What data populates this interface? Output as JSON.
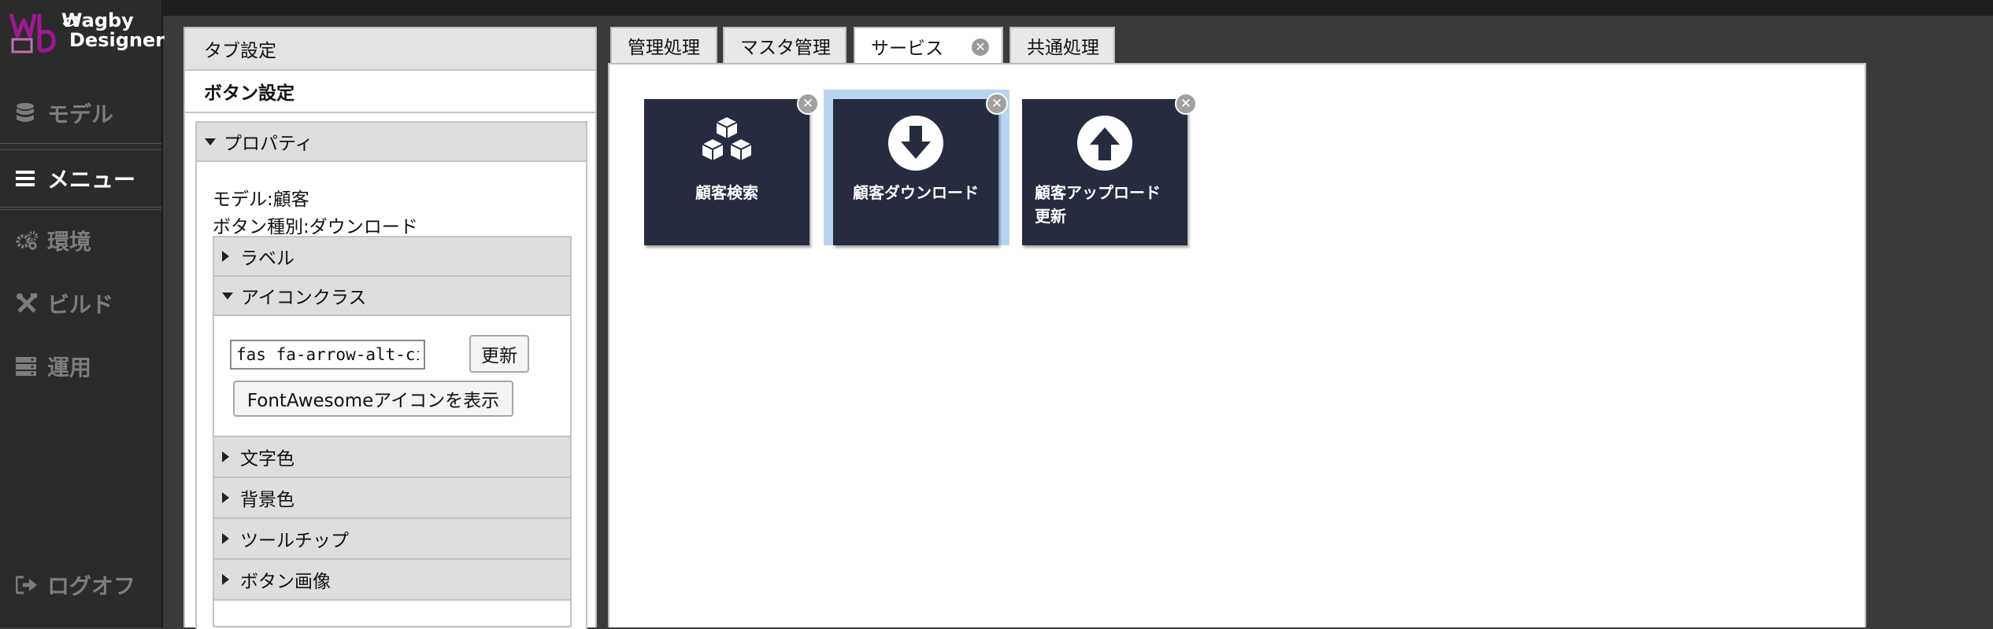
{
  "brand": {
    "line1": "Wagby",
    "line2": "Designer"
  },
  "nav": {
    "items": [
      {
        "label": "モデル",
        "icon": "database-icon"
      },
      {
        "label": "メニュー",
        "icon": "menu-bars-icon",
        "active": true
      },
      {
        "label": "環境",
        "icon": "cogs-icon"
      },
      {
        "label": "ビルド",
        "icon": "tools-icon"
      },
      {
        "label": "運用",
        "icon": "server-icon"
      }
    ],
    "logoff": "ログオフ"
  },
  "panel": {
    "tab_settings": "タブ設定",
    "button_settings": "ボタン設定",
    "properties": {
      "header": "プロパティ",
      "model_line": "モデル:顧客",
      "button_type_line": "ボタン種別:ダウンロード",
      "sections": {
        "label": "ラベル",
        "icon_class": "アイコンクラス",
        "text_color": "文字色",
        "bg_color": "背景色",
        "tooltip": "ツールチップ",
        "button_image": "ボタン画像"
      },
      "icon_class_value": "fas fa-arrow-alt-circle-down",
      "update_button": "更新",
      "fontawesome_button": "FontAwesomeアイコンを表示"
    }
  },
  "tabs": [
    {
      "label": "管理処理"
    },
    {
      "label": "マスタ管理"
    },
    {
      "label": "サービス",
      "active": true,
      "closable": true
    },
    {
      "label": "共通処理"
    }
  ],
  "tiles": [
    {
      "label": "顧客検索",
      "icon": "cubes-icon"
    },
    {
      "label": "顧客ダウンロード",
      "icon": "arrow-circle-down-icon",
      "selected": true
    },
    {
      "label_line1": "顧客アップロード",
      "label_line2": "更新",
      "icon": "arrow-circle-up-icon"
    }
  ],
  "colors": {
    "tile_bg": "#262b40",
    "selection": "#b8d4f0",
    "sidebar_bg": "#2b2b2b",
    "logo_accent": "#a01890"
  }
}
